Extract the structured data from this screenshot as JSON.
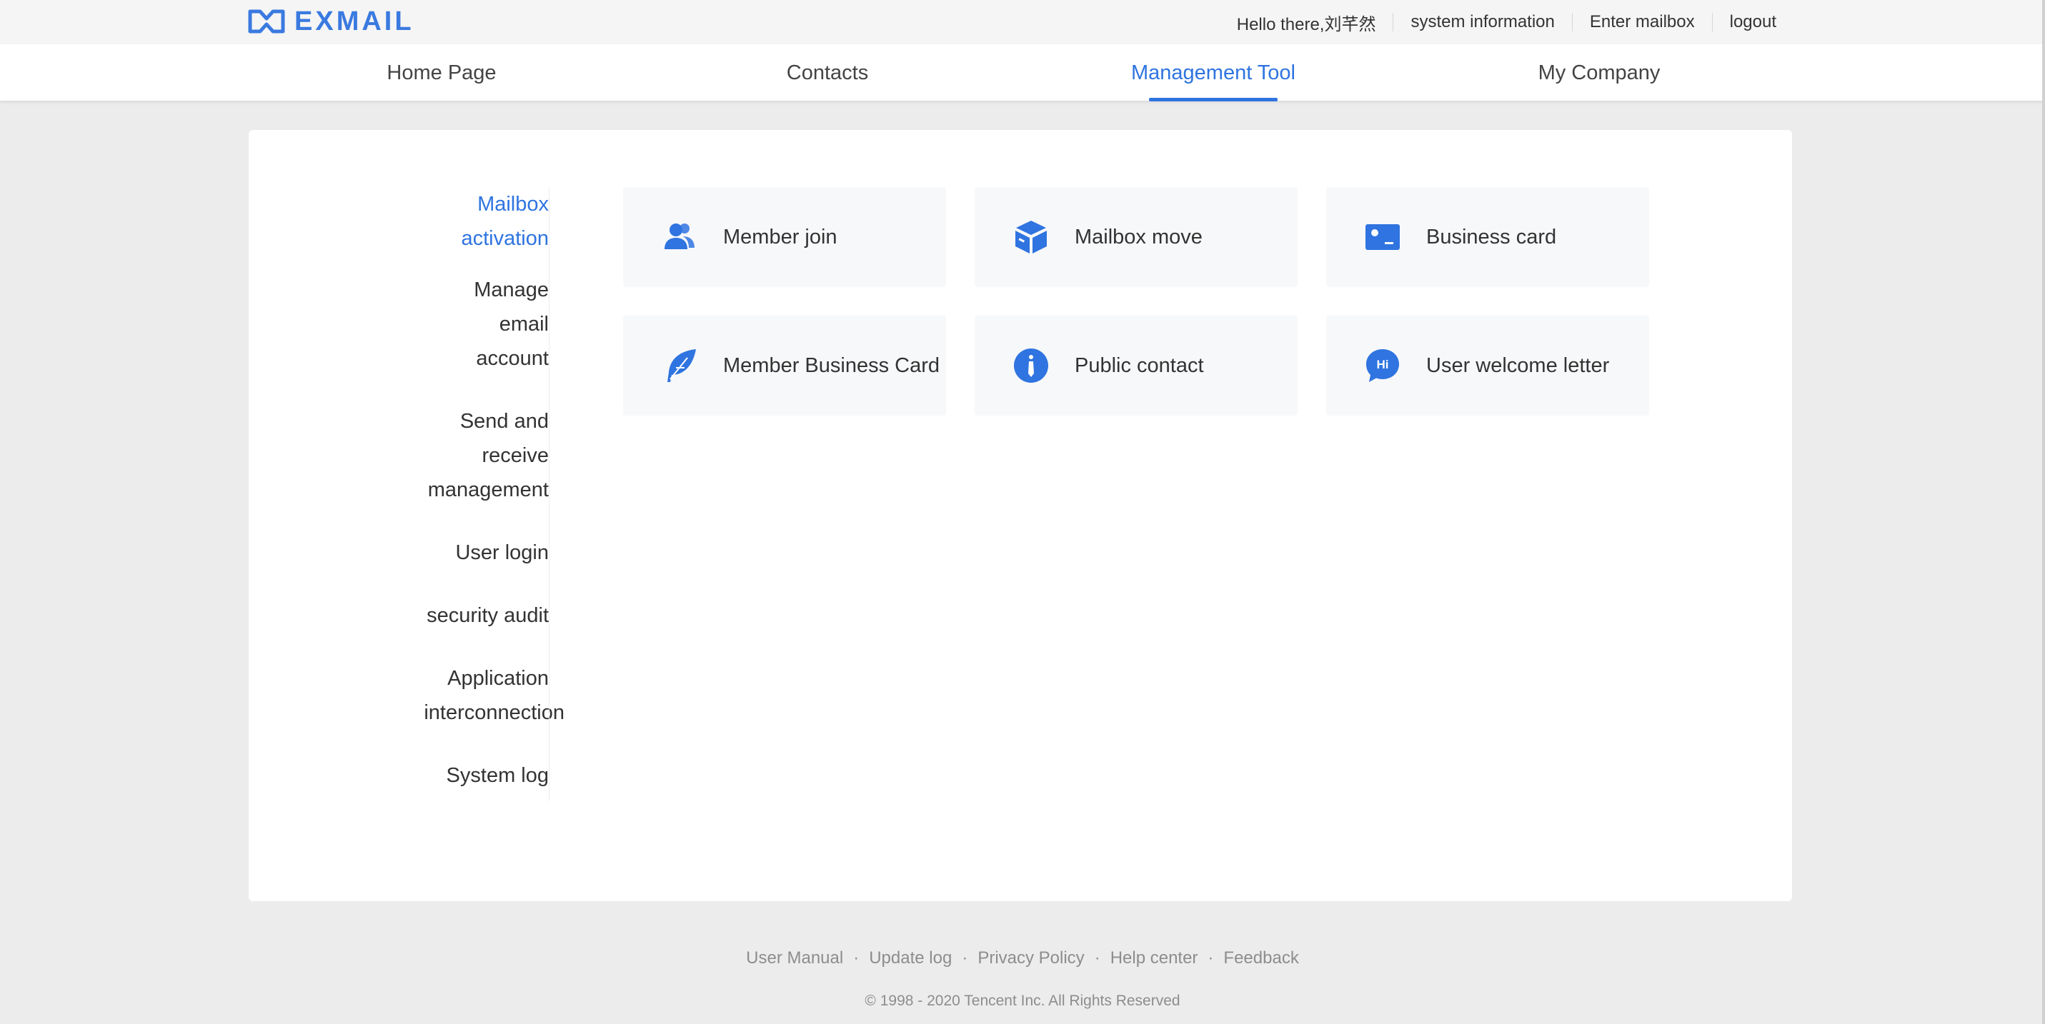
{
  "brand": {
    "name": "EXMAIL"
  },
  "topbar": {
    "greeting": "Hello there,刘芊然",
    "links": [
      "system information",
      "Enter mailbox",
      "logout"
    ]
  },
  "nav": {
    "items": [
      "Home Page",
      "Contacts",
      "Management Tool",
      "My Company"
    ],
    "active": "Management Tool"
  },
  "sidebar": {
    "items": [
      {
        "lines": [
          "Mailbox",
          "activation"
        ],
        "active": true
      },
      {
        "lines": [
          "Manage",
          "email",
          "account"
        ]
      },
      {
        "lines": [
          "Send and",
          "receive",
          "management"
        ]
      },
      {
        "lines": [
          "User login"
        ]
      },
      {
        "lines": [
          "security audit"
        ]
      },
      {
        "lines": [
          "Application",
          "interconnection"
        ]
      },
      {
        "lines": [
          "System log"
        ]
      }
    ]
  },
  "tiles": [
    {
      "label": "Member join",
      "icon": "members-icon"
    },
    {
      "label": "Mailbox move",
      "icon": "box-icon"
    },
    {
      "label": "Business card",
      "icon": "id-card-icon"
    },
    {
      "label": "Member Business Card",
      "icon": "feather-icon"
    },
    {
      "label": "Public contact",
      "icon": "info-icon"
    },
    {
      "label": "User welcome letter",
      "icon": "hi-chat-icon"
    }
  ],
  "footer": {
    "links": [
      "User Manual",
      "Update log",
      "Privacy Policy",
      "Help center",
      "Feedback"
    ],
    "copyright": "© 1998 - 2020 Tencent Inc. All Rights Reserved"
  },
  "colors": {
    "accent": "#2f74e0",
    "tile_bg": "#f7f8fa",
    "page_bg": "#ececec"
  }
}
